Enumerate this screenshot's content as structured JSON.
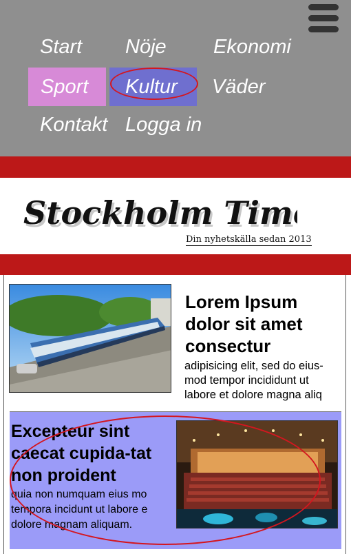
{
  "nav": {
    "items": [
      {
        "label": "Start"
      },
      {
        "label": "Nöje"
      },
      {
        "label": "Ekonomi"
      },
      {
        "label": "Sport"
      },
      {
        "label": "Kultur"
      },
      {
        "label": "Väder"
      },
      {
        "label": "Kontakt"
      },
      {
        "label": "Logga in"
      }
    ],
    "active_item": "Sport",
    "highlighted_item": "Kultur",
    "active_color": "#d78ad7",
    "highlight_color": "#6f6fcf"
  },
  "masthead": {
    "title": "Stockholm Times",
    "tagline": "Din nyhetskälla sedan 2013",
    "accent_color": "#bc1818"
  },
  "articles": [
    {
      "headline": "Lorem Ipsum dolor sit amet consectur",
      "excerpt": "adipisicing elit, sed do eius-mod tempor incididunt ut labore et dolore magna aliq",
      "image": "tram-photo"
    },
    {
      "headline": "Excepteur sint caecat cupida-tat non proident",
      "excerpt": "quia non numquam eius mo tempora incidunt ut labore e dolore magnam aliquam.",
      "image": "theater-photo",
      "background": "#9b9bf8"
    }
  ],
  "icons": {
    "menu": "hamburger-menu-icon"
  }
}
